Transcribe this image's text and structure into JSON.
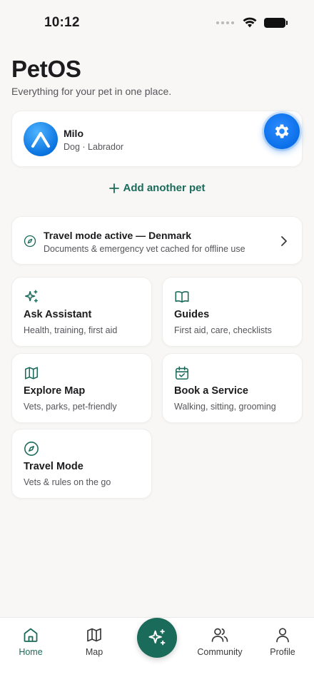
{
  "status_bar": {
    "time": "10:12"
  },
  "header": {
    "title": "PetOS",
    "subtitle": "Everything for your pet in one place."
  },
  "pet": {
    "name": "Milo",
    "meta": "Dog · Labrador",
    "avatar_icon": "dog-avatar",
    "settings_icon": "gear-icon"
  },
  "add_pet": {
    "label": "Add another pet"
  },
  "travel_banner": {
    "title": "Travel mode active — Denmark",
    "subtitle": "Documents & emergency vet cached for offline use"
  },
  "tiles": [
    {
      "title": "Ask Assistant",
      "subtitle": "Health, training, first aid",
      "icon": "sparkles-icon"
    },
    {
      "title": "Guides",
      "subtitle": "First aid, care, checklists",
      "icon": "book-icon"
    },
    {
      "title": "Explore Map",
      "subtitle": "Vets, parks, pet-friendly",
      "icon": "map-icon"
    },
    {
      "title": "Book a Service",
      "subtitle": "Walking, sitting, grooming",
      "icon": "calendar-check-icon"
    },
    {
      "title": "Travel Mode",
      "subtitle": "Vets & rules on the go",
      "icon": "compass-icon"
    }
  ],
  "tab_bar": {
    "items": [
      {
        "label": "Home",
        "icon": "home-icon",
        "active": true
      },
      {
        "label": "Map",
        "icon": "map-icon",
        "active": false
      },
      {
        "label": "Community",
        "icon": "users-icon",
        "active": false
      },
      {
        "label": "Profile",
        "icon": "user-icon",
        "active": false
      }
    ],
    "center_icon": "sparkles-icon"
  },
  "colors": {
    "accent": "#1b6b5a",
    "background": "#f8f7f5",
    "blue": "#0a6fe8"
  }
}
